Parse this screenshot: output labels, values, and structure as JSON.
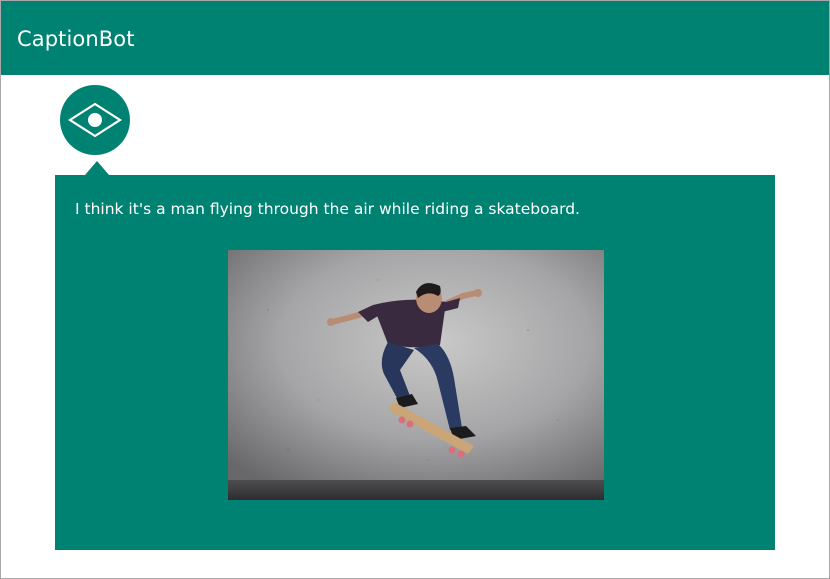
{
  "header": {
    "title": "CaptionBot",
    "color": "#008272"
  },
  "bot": {
    "avatar_icon": "eye-icon"
  },
  "message": {
    "caption": "I think it's a man flying through the air while riding a skateboard.",
    "image_subject": "skateboarder-photo"
  }
}
